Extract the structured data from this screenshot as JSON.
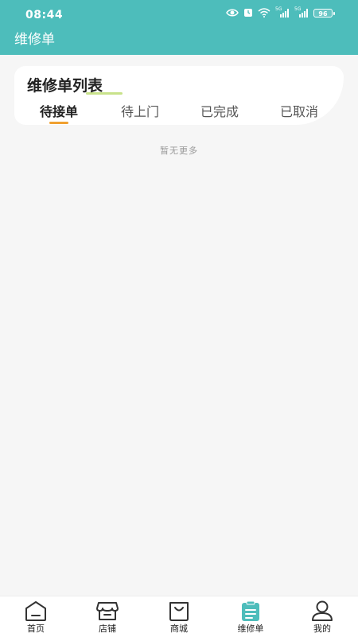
{
  "status_bar": {
    "time": "08:44",
    "battery": "96",
    "sig1": "5G",
    "sig2": "5G"
  },
  "header": {
    "title": "维修单"
  },
  "list": {
    "title": "维修单列表",
    "tabs": [
      "待接单",
      "待上门",
      "已完成",
      "已取消"
    ],
    "active_tab": 0,
    "empty_text": "暂无更多"
  },
  "tabbar": {
    "items": [
      {
        "label": "首页",
        "icon": "home-icon"
      },
      {
        "label": "店铺",
        "icon": "store-icon"
      },
      {
        "label": "商城",
        "icon": "shopping-bag-icon"
      },
      {
        "label": "维修单",
        "icon": "clipboard-icon"
      },
      {
        "label": "我的",
        "icon": "user-icon"
      }
    ],
    "active_index": 3
  },
  "colors": {
    "primary": "#4dbdbb",
    "tab_indicator": "#f0a030",
    "title_accent": "#c8e28a",
    "background": "#f6f6f6"
  }
}
